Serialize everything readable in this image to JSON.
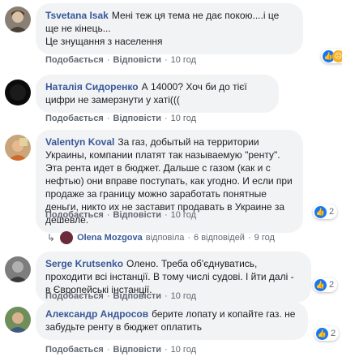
{
  "comments": [
    {
      "author": "Tsvetana Isak",
      "text": "Мені теж ця тема не дає покою....і це ще не кінець...",
      "text2": "Це знущання з населення",
      "like": "Подобається",
      "reply": "Відповісти",
      "time": "10 год",
      "reaction_count": "",
      "reaction_icons": [
        "like-icon",
        "sad-icon"
      ]
    },
    {
      "author": "Наталія Сидоренко",
      "text": "А 14000? Хоч би до тієї цифри не замерзнути у хаті(((",
      "like": "Подобається",
      "reply": "Відповісти",
      "time": "10 год"
    },
    {
      "author": "Valentyn Koval",
      "text": "За газ, добытый на территории Украины, компании платят так называемую \"ренту\". Эта рента идет в бюджет. Дальше с газом (как и с нефтью) они вправе поступать, как угодно. И если при продаже за границу можно заработать понятные деньги, никто их не заставит продавать в Украине за дешевле.",
      "like": "Подобається",
      "reply": "Відповісти",
      "time": "10 год",
      "reaction_count": "2",
      "reaction_icons": [
        "like-icon"
      ]
    },
    {
      "author": "Serge Krutsenko",
      "text": "Олено. Треба об'єднуватись, проходити всі інстанції. В тому числі судові. І йти далі - в Європейські інстанції.",
      "like": "Подобається",
      "reply": "Відповісти",
      "time": "10 год",
      "reaction_count": "2",
      "reaction_icons": [
        "like-icon"
      ]
    },
    {
      "author": "Александр Андросов",
      "text": "берите лопату и копайте газ. не забудьте ренту в бюджет оплатить",
      "like": "Подобається",
      "reply": "Відповісти",
      "time": "10 год",
      "reaction_count": "2",
      "reaction_icons": [
        "like-icon"
      ]
    }
  ],
  "reply_summary": {
    "name": "Olena Mozgova",
    "action": "відповіла",
    "replies": "6 відповідей",
    "time": "9 год"
  },
  "colors": {
    "link": "#385898",
    "bubble": "#f2f3f5",
    "like": "#1877f2",
    "meta": "#606770"
  }
}
